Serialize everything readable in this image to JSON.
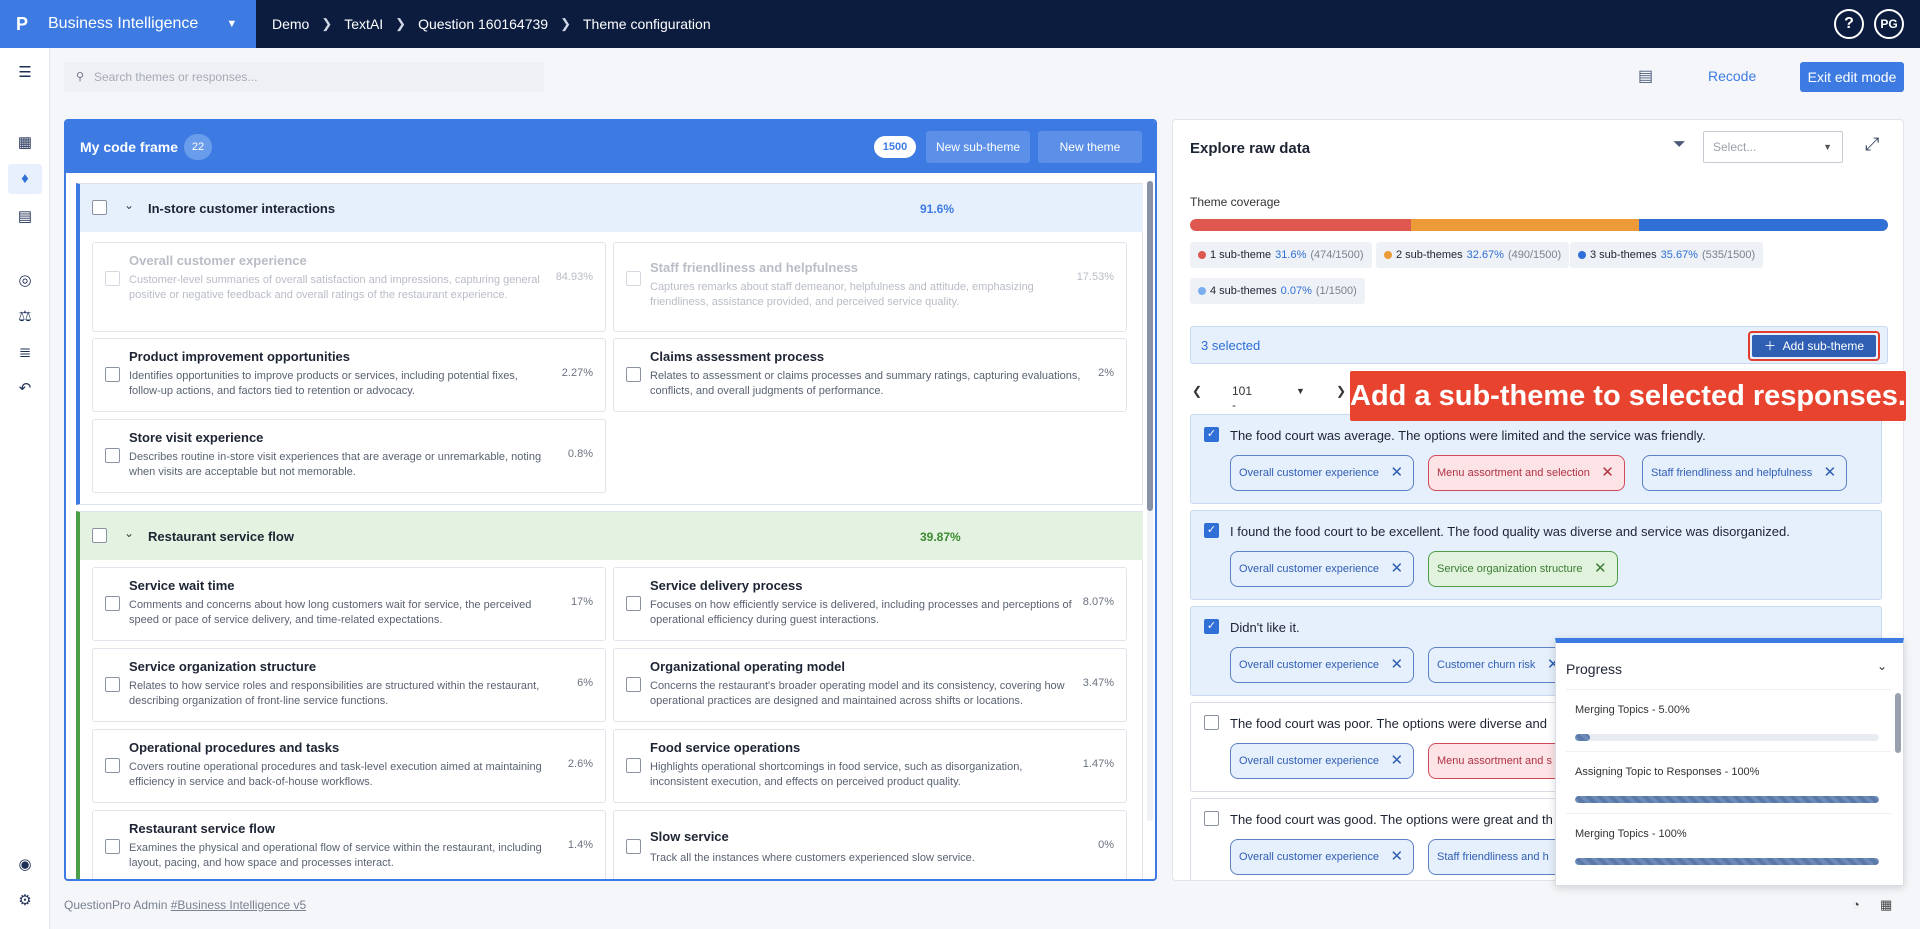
{
  "app": {
    "logo": "P",
    "name": "Business Intelligence"
  },
  "breadcrumb": [
    "Demo",
    "TextAI",
    "Question 160164739",
    "Theme configuration"
  ],
  "header": {
    "help": "?",
    "avatar": "PG",
    "search_placeholder": "Search themes or responses...",
    "recode": "Recode",
    "exit_edit": "Exit edit mode"
  },
  "codeframe": {
    "title": "My code frame",
    "count": "22",
    "total": "1500",
    "new_subtheme": "New sub-theme",
    "new_theme": "New theme",
    "groups": [
      {
        "name": "In-store customer interactions",
        "pct": "91.6%",
        "items": [
          {
            "title": "Overall customer experience",
            "desc": "Customer-level summaries of overall satisfaction and impressions, capturing general positive or negative feedback and overall ratings of the restaurant experience.",
            "pct": "84.93%"
          },
          {
            "title": "Staff friendliness and helpfulness",
            "desc": "Captures remarks about staff demeanor, helpfulness and attitude, emphasizing friendliness, assistance provided, and perceived service quality.",
            "pct": "17.53%"
          },
          {
            "title": "Product improvement opportunities",
            "desc": "Identifies opportunities to improve products or services, including potential fixes, follow-up actions, and factors tied to retention or advocacy.",
            "pct": "2.27%"
          },
          {
            "title": "Claims assessment process",
            "desc": "Relates to assessment or claims processes and summary ratings, capturing evaluations, conflicts, and overall judgments of performance.",
            "pct": "2%"
          },
          {
            "title": "Store visit experience",
            "desc": "Describes routine in-store visit experiences that are average or unremarkable, noting when visits are acceptable but not memorable.",
            "pct": "0.8%"
          }
        ]
      },
      {
        "name": "Restaurant service flow",
        "pct": "39.87%",
        "items": [
          {
            "title": "Service wait time",
            "desc": "Comments and concerns about how long customers wait for service, the perceived speed or pace of service delivery, and time-related expectations.",
            "pct": "17%"
          },
          {
            "title": "Service delivery process",
            "desc": "Focuses on how efficiently service is delivered, including processes and perceptions of operational efficiency during guest interactions.",
            "pct": "8.07%"
          },
          {
            "title": "Service organization structure",
            "desc": "Relates to how service roles and responsibilities are structured within the restaurant, describing organization of front-line service functions.",
            "pct": "6%"
          },
          {
            "title": "Organizational operating model",
            "desc": "Concerns the restaurant's broader operating model and its consistency, covering how operational practices are designed and maintained across shifts or locations.",
            "pct": "3.47%"
          },
          {
            "title": "Operational procedures and tasks",
            "desc": "Covers routine operational procedures and task-level execution aimed at maintaining efficiency in service and back-of-house workflows.",
            "pct": "2.6%"
          },
          {
            "title": "Food service operations",
            "desc": "Highlights operational shortcomings in food service, such as disorganization, inconsistent execution, and effects on perceived product quality.",
            "pct": "1.47%"
          },
          {
            "title": "Restaurant service flow",
            "desc": "Examines the physical and operational flow of service within the restaurant, including layout, pacing, and how space and processes interact.",
            "pct": "1.4%"
          },
          {
            "title": "Slow service",
            "desc": "Track all the instances where customers experienced slow service.",
            "pct": "0%"
          }
        ]
      }
    ]
  },
  "explore": {
    "title": "Explore raw data",
    "select_placeholder": "Select...",
    "coverage_label": "Theme coverage",
    "coverage": [
      {
        "name": "1 sub-theme",
        "pct": "31.6%",
        "count": "(474/1500)",
        "fraction": 0.316,
        "color": "#de5850"
      },
      {
        "name": "2 sub-themes",
        "pct": "32.67%",
        "count": "(490/1500)",
        "fraction": 0.3267,
        "color": "#ec9b38"
      },
      {
        "name": "3 sub-themes",
        "pct": "35.67%",
        "count": "(535/1500)",
        "fraction": 0.3567,
        "color": "#2f6fd6"
      },
      {
        "name": "4 sub-themes",
        "pct": "0.07%",
        "count": "(1/1500)",
        "fraction": 0.0007,
        "color": "#7aaef0"
      }
    ],
    "selected_text": "3 selected",
    "add_subtheme": "Add sub-theme",
    "pager_range": "101 - 200",
    "callout": "Add a sub-theme to selected responses.",
    "responses": [
      {
        "text": "The food court was average. The options were limited and the service was friendly.",
        "checked": true,
        "tags": [
          "Overall customer experience",
          "Menu assortment and selection",
          "Staff friendliness and helpfulness"
        ]
      },
      {
        "text": "I found the food court to be excellent. The food quality was diverse and service was disorganized.",
        "checked": true,
        "tags": [
          "Overall customer experience",
          "Service organization structure"
        ]
      },
      {
        "text": "Didn't like it.",
        "checked": true,
        "tags": [
          "Overall customer experience",
          "Customer churn risk"
        ]
      },
      {
        "text": "The food court was poor. The options were diverse and",
        "checked": false,
        "tags": [
          "Overall customer experience",
          "Menu assortment and s"
        ]
      },
      {
        "text": "The food court was good. The options were great and th",
        "checked": false,
        "tags": [
          "Overall customer experience",
          "Staff friendliness and h"
        ]
      }
    ]
  },
  "progress": {
    "title": "Progress",
    "items": [
      {
        "label": "Merging Topics - 5.00%",
        "value": 0.05
      },
      {
        "label": "Assigning Topic to Responses - 100%",
        "value": 1.0
      },
      {
        "label": "Merging Topics - 100%",
        "value": 1.0
      }
    ]
  },
  "footer": {
    "text": "QuestionPro Admin",
    "link": "#Business Intelligence v5"
  }
}
